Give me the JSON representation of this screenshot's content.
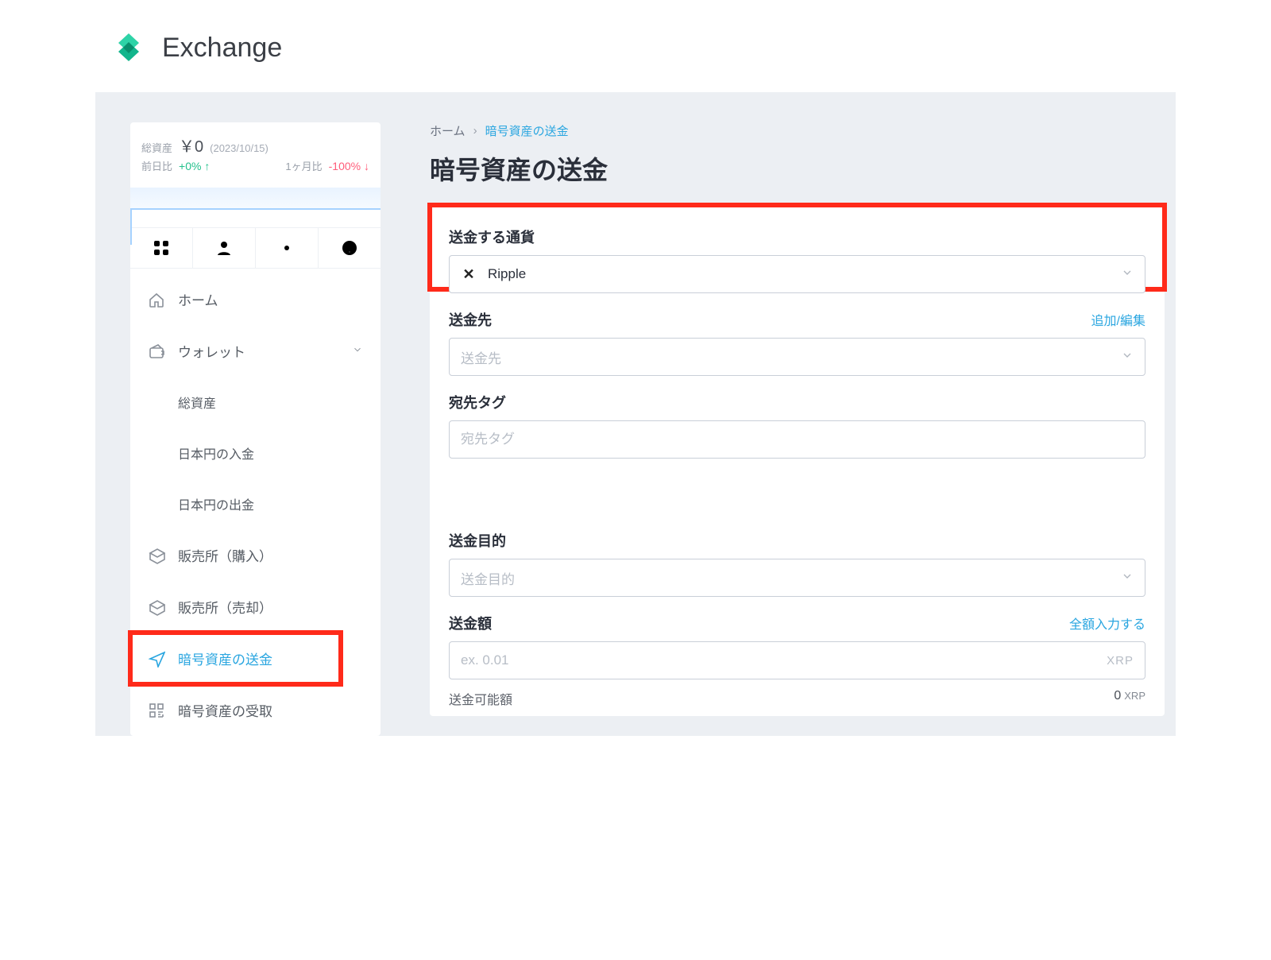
{
  "header": {
    "app_name": "Exchange"
  },
  "sidebar": {
    "stats": {
      "total_label": "総資産",
      "total_value": "￥0",
      "as_of": "(2023/10/15)",
      "day_label": "前日比",
      "day_value": "+0% ↑",
      "month_label": "1ヶ月比",
      "month_value": "-100% ↓"
    },
    "nav": {
      "home": "ホーム",
      "wallet": "ウォレット",
      "wallet_sub": {
        "total": "総資産",
        "deposit_jpy": "日本円の入金",
        "withdraw_jpy": "日本円の出金"
      },
      "buy": "販売所（購入）",
      "sell": "販売所（売却）",
      "send": "暗号資産の送金",
      "receive": "暗号資産の受取"
    }
  },
  "breadcrumb": {
    "home": "ホーム",
    "current": "暗号資産の送金"
  },
  "page_title": "暗号資産の送金",
  "form": {
    "currency": {
      "label": "送金する通貨",
      "selected": "Ripple"
    },
    "destination": {
      "label": "送金先",
      "placeholder": "送金先",
      "edit_link": "追加/編集"
    },
    "tag": {
      "label": "宛先タグ",
      "placeholder": "宛先タグ"
    },
    "purpose": {
      "label": "送金目的",
      "placeholder": "送金目的"
    },
    "amount": {
      "label": "送金額",
      "placeholder": "ex. 0.01",
      "unit": "XRP",
      "fill_all": "全額入力する",
      "available_label": "送金可能額",
      "available_value": "0",
      "available_unit": "XRP"
    }
  }
}
